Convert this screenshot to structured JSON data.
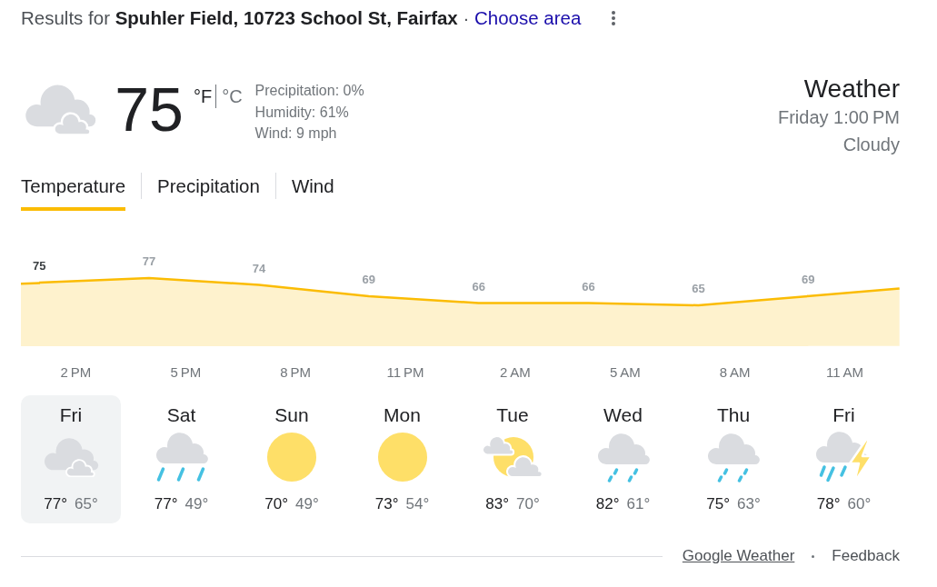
{
  "header": {
    "text": "Results for **Spuhler Field, 10723 School St, Fairfax** ·",
    "link": "Choose area"
  },
  "current": {
    "kind": "cloudy",
    "temperature": "75",
    "units": [
      {
        "label": "°F",
        "selected": true
      },
      {
        "label": "°C",
        "selected": false
      }
    ],
    "details": [
      "Precipitation: 0%",
      "Humidity: 61%",
      "Wind: 9 mph"
    ]
  },
  "summary": {
    "title": "Weather",
    "time": "Friday 1:00 PM",
    "condition": "Cloudy"
  },
  "tabs": [
    {
      "label": "Temperature",
      "selected": true
    },
    {
      "label": "Precipitation",
      "selected": false
    },
    {
      "label": "Wind",
      "selected": false
    }
  ],
  "hourly": {
    "chart_data": {
      "type": "area",
      "categories": [
        null,
        "2 PM",
        null,
        null,
        "5 PM",
        null,
        null,
        "8 PM",
        null,
        null,
        "11 PM",
        null,
        null,
        "2 AM",
        null,
        null,
        "5 AM",
        null,
        null,
        "8 AM",
        null,
        null,
        "11 AM",
        null
      ],
      "series": [
        {
          "color": "#fbbc04",
          "values": [
            75,
            null,
            null,
            77,
            null,
            null,
            74,
            null,
            null,
            69,
            null,
            null,
            66,
            null,
            null,
            66,
            null,
            null,
            65,
            null,
            null,
            69,
            null,
            null
          ]
        }
      ],
      "data_labels": true
    }
  },
  "days": [
    {
      "day": "Fri",
      "kind": "cloudy",
      "high": "77°",
      "low": "65°",
      "selected": true
    },
    {
      "day": "Sat",
      "kind": "rain",
      "high": "77°",
      "low": "49°",
      "selected": false
    },
    {
      "day": "Sun",
      "kind": "sunny",
      "high": "70°",
      "low": "49°",
      "selected": false
    },
    {
      "day": "Mon",
      "kind": "sunny",
      "high": "73°",
      "low": "54°",
      "selected": false
    },
    {
      "day": "Tue",
      "kind": "partly_cloudy",
      "high": "83°",
      "low": "70°",
      "selected": false
    },
    {
      "day": "Wed",
      "kind": "light_rain",
      "high": "82°",
      "low": "61°",
      "selected": false
    },
    {
      "day": "Thu",
      "kind": "light_rain",
      "high": "75°",
      "low": "63°",
      "selected": false
    },
    {
      "day": "Fri",
      "kind": "thunderstorm",
      "high": "78°",
      "low": "60°",
      "selected": false
    }
  ],
  "footer": {
    "links": [
      {
        "label": "Google Weather",
        "underlined": true
      },
      {
        "label": "Feedback",
        "underlined": false
      }
    ]
  }
}
